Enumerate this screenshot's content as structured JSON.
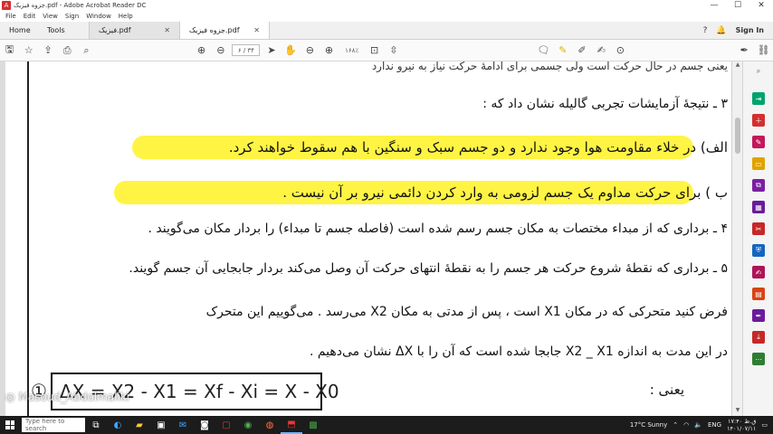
{
  "window": {
    "title": "جزوه فیزیک.pdf - Adobe Acrobat Reader DC",
    "controls": [
      "—",
      "☐",
      "✕"
    ]
  },
  "menu": [
    "File",
    "Edit",
    "View",
    "Sign",
    "Window",
    "Help"
  ],
  "tabs": {
    "home": "Home",
    "tools": "Tools",
    "documents": [
      {
        "label": "فیزیک.pdf",
        "close": "✕"
      },
      {
        "label": "جزوه فیزیک.pdf",
        "close": "✕"
      }
    ],
    "sign_in": "Sign In"
  },
  "toolbar": {
    "page_display": "۶ / ۳۴",
    "zoom_display": "۱۶۸٪"
  },
  "document": {
    "lines": [
      "یعنی جسم در حال حرکت است ولی جسمی برای ادامهٔ حرکت نیاز به نیرو ندارد",
      "۳ ـ نتیجهٔ آزمایشات تجربی گالیله نشان داد که :",
      "الف)   در خلاء مقاومت هوا وجود ندارد  و  دو جسم سبک و سنگین با هم سقوط خواهند کرد.",
      "ب )  برای حرکت مداوم یک جسم لزومی به وارد کردن دائمی نیرو بر آن نیست .",
      "۴ ـ برداری که از مبداء مختصات به مکان جسم رسم شده است (فاصله جسم تا مبداء) را بردار مکان می‌گویند .",
      "۵ ـ برداری که نقطهٔ شروع حرکت هر جسم را به نقطهٔ انتهای حرکت آن وصل می‌کند بردار جابجایی آن جسم گویند.",
      "فرض کنید متحرکی که در مکان X1 است ، پس از مدتی به مکان X2 می‌رسد . می‌گوییم این متحرک",
      "در این مدت به اندازه     X2 _ X1    جابجا شده است که آن را با  ΔX  نشان می‌دهیم .",
      "یعنی :"
    ],
    "formula": "ΔX = X2 - X1 = Xf - Xi = X - X0",
    "formula_number": "①"
  },
  "watermark": "Masoud_Abdolmaliki",
  "taskbar": {
    "search_placeholder": "Type here to search",
    "weather": "17°C  Sunny",
    "language": "ENG",
    "time": "۱۷:۴۰ ق.ظ",
    "date": "۱۴۰۱/۰۷/۱۱"
  },
  "colors": {
    "highlight": "#fff33a",
    "acrobat_red": "#d32f2f",
    "taskbar": "#1c1c1c"
  }
}
